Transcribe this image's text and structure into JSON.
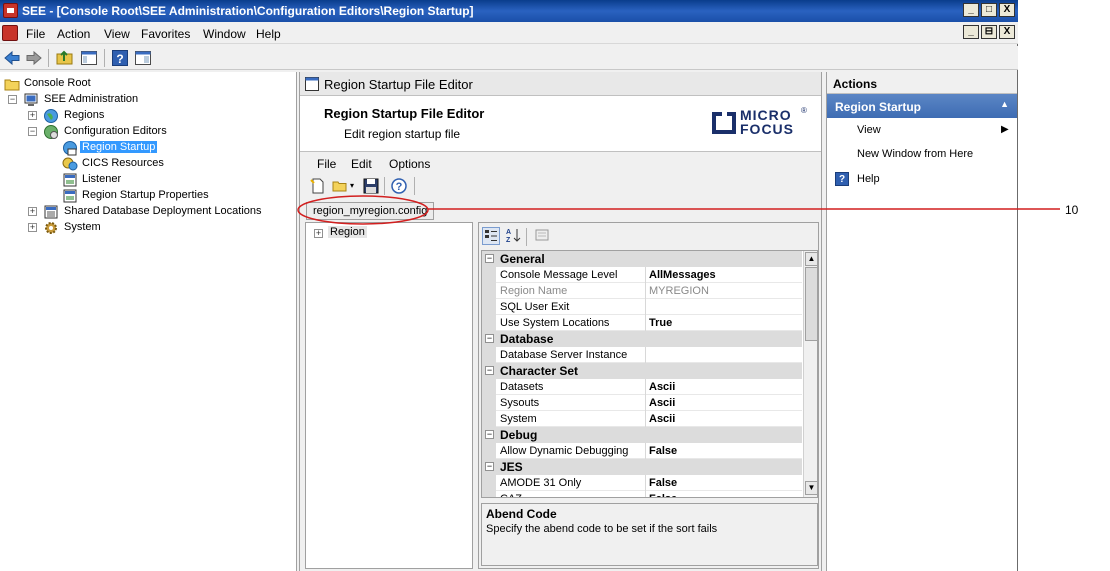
{
  "window": {
    "title": "SEE - [Console Root\\SEE Administration\\Configuration Editors\\Region Startup]",
    "outer_buttons": [
      "_",
      "□",
      "X"
    ],
    "inner_buttons": [
      "_",
      "⊟",
      "X"
    ]
  },
  "menubar": {
    "items": [
      "File",
      "Action",
      "View",
      "Favorites",
      "Window",
      "Help"
    ]
  },
  "tree": {
    "items": [
      {
        "label": "Console Root",
        "expander": ""
      },
      {
        "label": "SEE Administration",
        "expander": "−"
      },
      {
        "label": "Regions",
        "expander": "+"
      },
      {
        "label": "Configuration Editors",
        "expander": "−"
      },
      {
        "label": "Region Startup",
        "expander": ""
      },
      {
        "label": "CICS Resources",
        "expander": ""
      },
      {
        "label": "Listener",
        "expander": ""
      },
      {
        "label": "Region Startup Properties",
        "expander": ""
      },
      {
        "label": "Shared Database Deployment Locations",
        "expander": "+"
      },
      {
        "label": "System",
        "expander": "+"
      }
    ]
  },
  "editor": {
    "header_title": "Region Startup File Editor",
    "banner_title": "Region Startup File Editor",
    "banner_subtitle": "Edit region startup file",
    "logo_line1": "MICRO",
    "logo_line2": "FOCUS",
    "logo_reg": "®",
    "menu": [
      "File",
      "Edit",
      "Options"
    ],
    "file_tab": "region_myregion.config",
    "tree_root": {
      "label": "Region",
      "expander": "+"
    },
    "categories": [
      {
        "name": "General",
        "expander": "−",
        "props": [
          {
            "name": "Console Message Level",
            "value": "AllMessages",
            "disabled": false
          },
          {
            "name": "Region Name",
            "value": "MYREGION",
            "disabled": true
          },
          {
            "name": "SQL User Exit",
            "value": "",
            "disabled": false
          },
          {
            "name": "Use System Locations",
            "value": "True",
            "disabled": false
          }
        ]
      },
      {
        "name": "Database",
        "expander": "−",
        "props": [
          {
            "name": "Database Server Instance",
            "value": "",
            "disabled": false
          }
        ]
      },
      {
        "name": "Character Set",
        "expander": "−",
        "props": [
          {
            "name": "Datasets",
            "value": "Ascii",
            "disabled": false
          },
          {
            "name": "Sysouts",
            "value": "Ascii",
            "disabled": false
          },
          {
            "name": "System",
            "value": "Ascii",
            "disabled": false
          }
        ]
      },
      {
        "name": "Debug",
        "expander": "−",
        "props": [
          {
            "name": "Allow Dynamic Debugging",
            "value": "False",
            "disabled": false
          }
        ]
      },
      {
        "name": "JES",
        "expander": "−",
        "props": [
          {
            "name": "AMODE 31 Only",
            "value": "False",
            "disabled": false
          },
          {
            "name": "CAZ",
            "value": "False",
            "disabled": false
          }
        ]
      }
    ],
    "description_title": "Abend Code",
    "description_text": "Specify the abend code to be set if the sort fails"
  },
  "actions": {
    "header": "Actions",
    "section": "Region Startup",
    "items": [
      {
        "label": "View",
        "submenu": "▶"
      },
      {
        "label": "New Window from Here",
        "submenu": ""
      },
      {
        "label": "Help",
        "submenu": ""
      }
    ]
  },
  "callout": {
    "number": "10"
  },
  "colors": {
    "title_bar": "#1a4fa8",
    "selection": "#3399ff",
    "actions_section": "#4a77bb",
    "callout": "#d21f1f"
  }
}
